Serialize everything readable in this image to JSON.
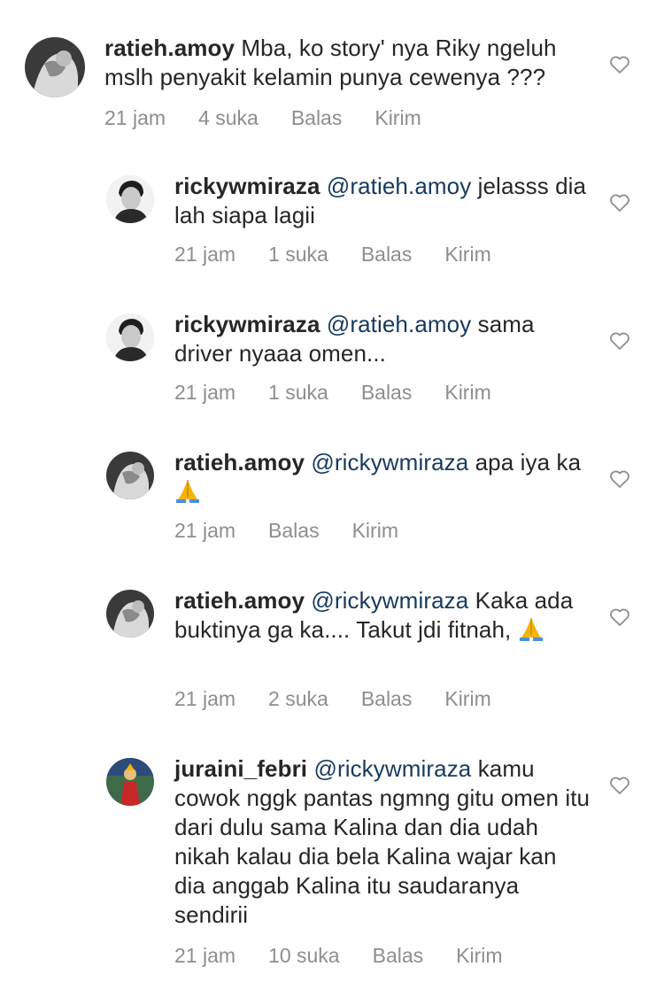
{
  "comments": [
    {
      "username": "ratieh.amoy",
      "mention": "",
      "text": "Mba, ko story' nya Riky ngeluh mslh penyakit kelamin punya cewenya ???",
      "time": "21 jam",
      "likes": "4 suka",
      "reply_label": "Balas",
      "send_label": "Kirim"
    },
    {
      "username": "rickywmiraza",
      "mention": "@ratieh.amoy",
      "text": "jelasss dia lah siapa lagii",
      "time": "21 jam",
      "likes": "1 suka",
      "reply_label": "Balas",
      "send_label": "Kirim"
    },
    {
      "username": "rickywmiraza",
      "mention": "@ratieh.amoy",
      "text": "sama driver nyaaa omen...",
      "time": "21 jam",
      "likes": "1 suka",
      "reply_label": "Balas",
      "send_label": "Kirim"
    },
    {
      "username": "ratieh.amoy",
      "mention": "@rickywmiraza",
      "text": "apa iya ka",
      "emoji": "folded-hands",
      "time": "21 jam",
      "likes": "",
      "reply_label": "Balas",
      "send_label": "Kirim"
    },
    {
      "username": "ratieh.amoy",
      "mention": "@rickywmiraza",
      "text": "Kaka ada buktinya ga ka.... Takut jdi fitnah,",
      "emoji": "folded-hands",
      "time": "21 jam",
      "likes": "2 suka",
      "reply_label": "Balas",
      "send_label": "Kirim"
    },
    {
      "username": "juraini_febri",
      "mention": "@rickywmiraza",
      "text": "kamu cowok nggk pantas ngmng gitu omen itu dari dulu sama Kalina dan dia udah nikah kalau dia bela Kalina wajar kan dia anggab Kalina itu saudaranya sendirii",
      "time": "21 jam",
      "likes": "10 suka",
      "reply_label": "Balas",
      "send_label": "Kirim"
    }
  ],
  "icons": {
    "like": "heart-outline-icon",
    "emoji": "folded-hands-emoji"
  },
  "colors": {
    "text": "#262626",
    "mention": "#173a5e",
    "meta": "#8e8e8e"
  }
}
